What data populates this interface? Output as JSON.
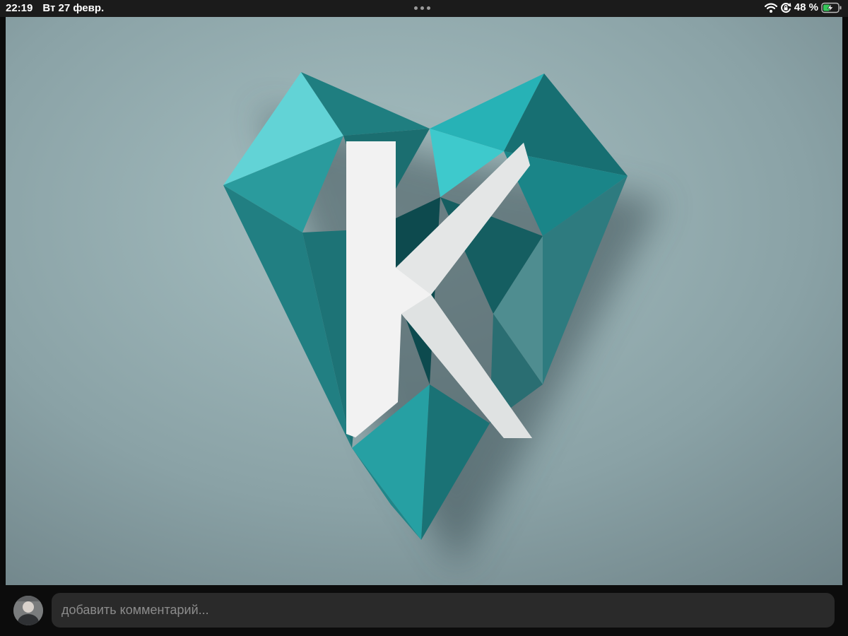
{
  "status_bar": {
    "time": "22:19",
    "date": "Вт 27 февр.",
    "battery_percent": "48 %",
    "battery_level": 0.48,
    "multitask_icon": "three-dots-icon",
    "wifi_icon": "wifi-icon",
    "orientation_lock_icon": "orientation-lock-icon",
    "battery_icon": "battery-charging-icon"
  },
  "post_image": {
    "logo_letter": "K"
  },
  "comment_bar": {
    "avatar_icon": "user-avatar",
    "placeholder": "добавить комментарий..."
  },
  "colors": {
    "status_bar_bg": "#1b1b1b",
    "image_background": "#8fa8ab",
    "gem_teal": "#1f8c8c",
    "gem_light": "#5fd6d8",
    "letter": "#f2f2f2",
    "battery_fill": "#34c759",
    "input_bg": "#2a2a2a"
  }
}
